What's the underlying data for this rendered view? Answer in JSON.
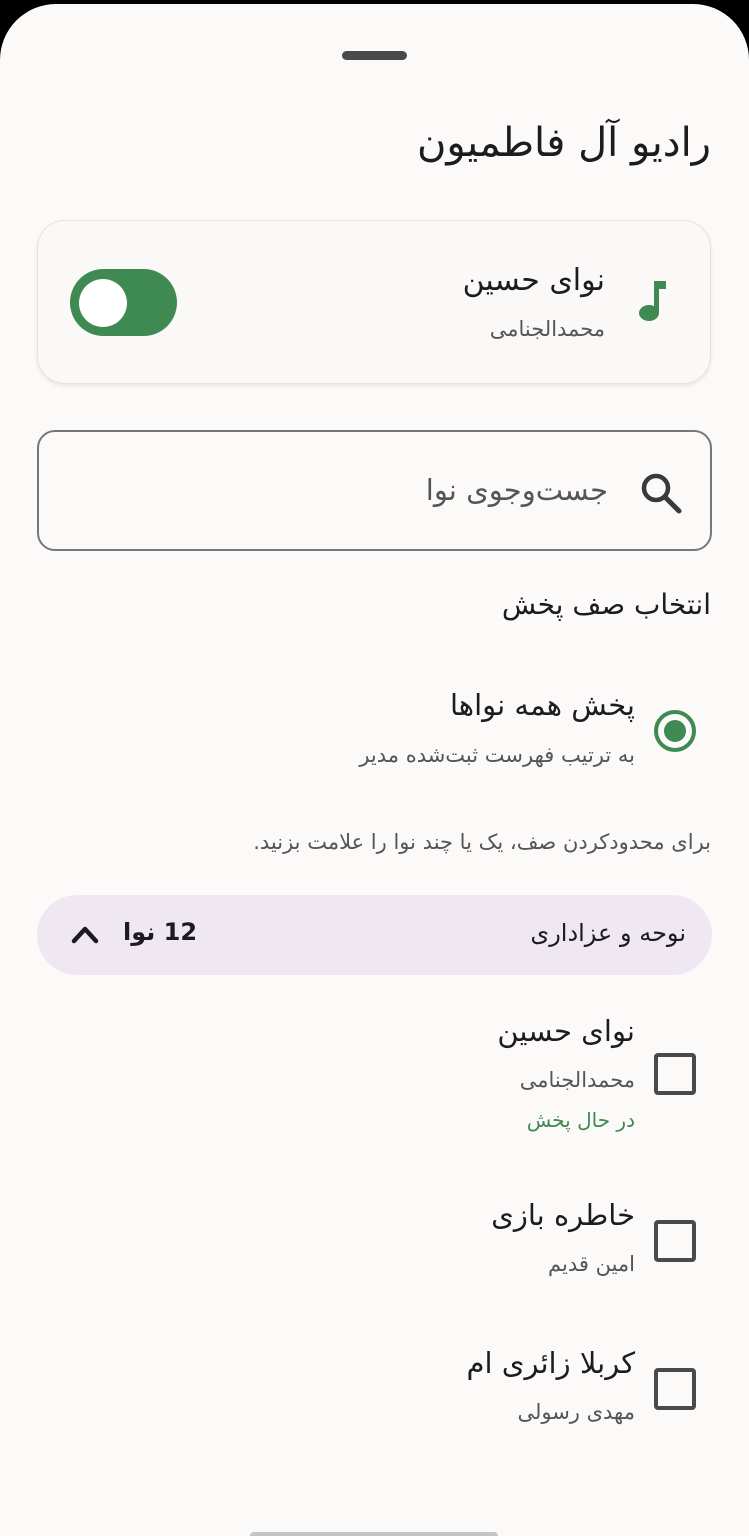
{
  "sheet": {
    "title": "رادیو آل فاطمیون"
  },
  "now_playing": {
    "icon": "music-note-icon",
    "title": "نوای حسین",
    "artist": "محمدالجنامی",
    "toggle_on": true
  },
  "search": {
    "icon": "search-icon",
    "placeholder": "جست‌وجوی نوا",
    "value": ""
  },
  "queue": {
    "section_title": "انتخاب صف پخش",
    "play_all": {
      "title": "پخش همه نواها",
      "subtitle": "به ترتیب فهرست ثبت‌شده مدیر",
      "selected": true
    },
    "hint": "برای محدودکردن صف، یک یا چند نوا را علامت بزنید."
  },
  "category": {
    "name": "نوحه و عزاداری",
    "count": "12 نوا",
    "icon": "chevron-up-icon",
    "expanded": true
  },
  "tracks": [
    {
      "title": "نوای حسین",
      "artist": "محمدالجنامی",
      "status": "در حال پخش",
      "checked": false
    },
    {
      "title": "خاطره بازی",
      "artist": "امین قدیم",
      "status": "",
      "checked": false
    },
    {
      "title": "کربلا زائری ام",
      "artist": "مهدی رسولی",
      "status": "",
      "checked": false
    }
  ],
  "colors": {
    "accent": "#3e8a52",
    "sheet_background": "#fcf9f9",
    "category_background": "#efe8f3"
  }
}
